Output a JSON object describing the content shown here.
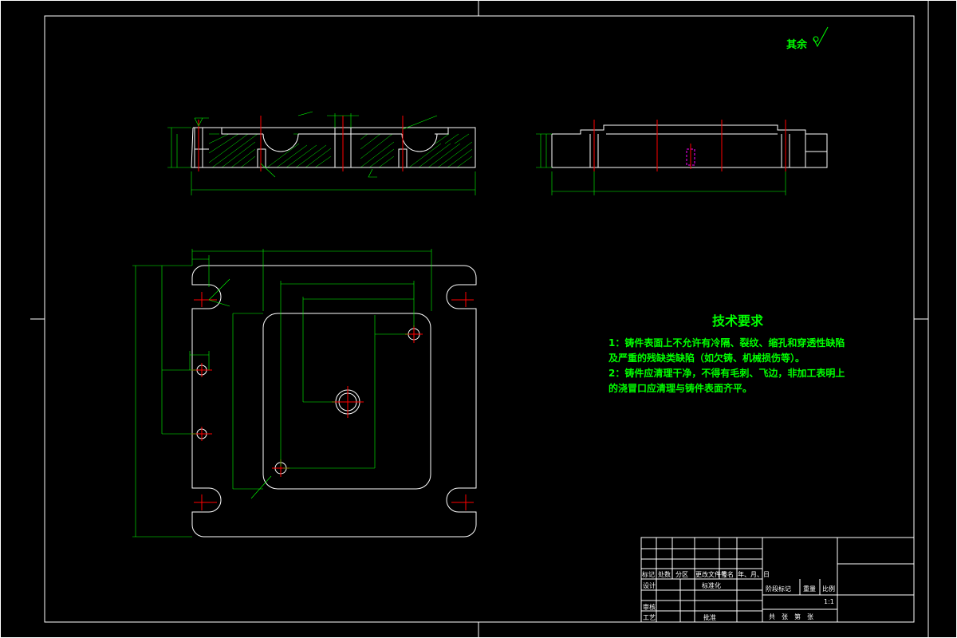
{
  "roughness": {
    "label": "其余"
  },
  "tech_requirements": {
    "title": "技术要求",
    "lines": [
      "1：铸件表面上不允许有冷隔、裂纹、缩孔和穿透性缺陷",
      "及严重的残缺类缺陷（如欠铸、机械损伤等）。",
      "2：铸件应清理干净，不得有毛刺、飞边，非加工表明上",
      "的浇冒口应清理与铸件表面齐平。"
    ]
  },
  "title_block": {
    "row_labels": [
      "标记",
      "处数",
      "分区",
      "更改文件号",
      "签名",
      "年、月、日"
    ],
    "design": "设计",
    "standardization": "标准化",
    "stage_mark": "阶段标记",
    "weight": "重量",
    "scale_label": "比例",
    "scale": "1:1",
    "review": "审核",
    "process": "工艺",
    "approve": "批准",
    "sheets": "共　张　第　张"
  },
  "colors": {
    "background": "#000000",
    "outline": "#ffffff",
    "dimension": "#00ff00",
    "centerline": "#ff0000",
    "hidden": "#ff00ff"
  }
}
